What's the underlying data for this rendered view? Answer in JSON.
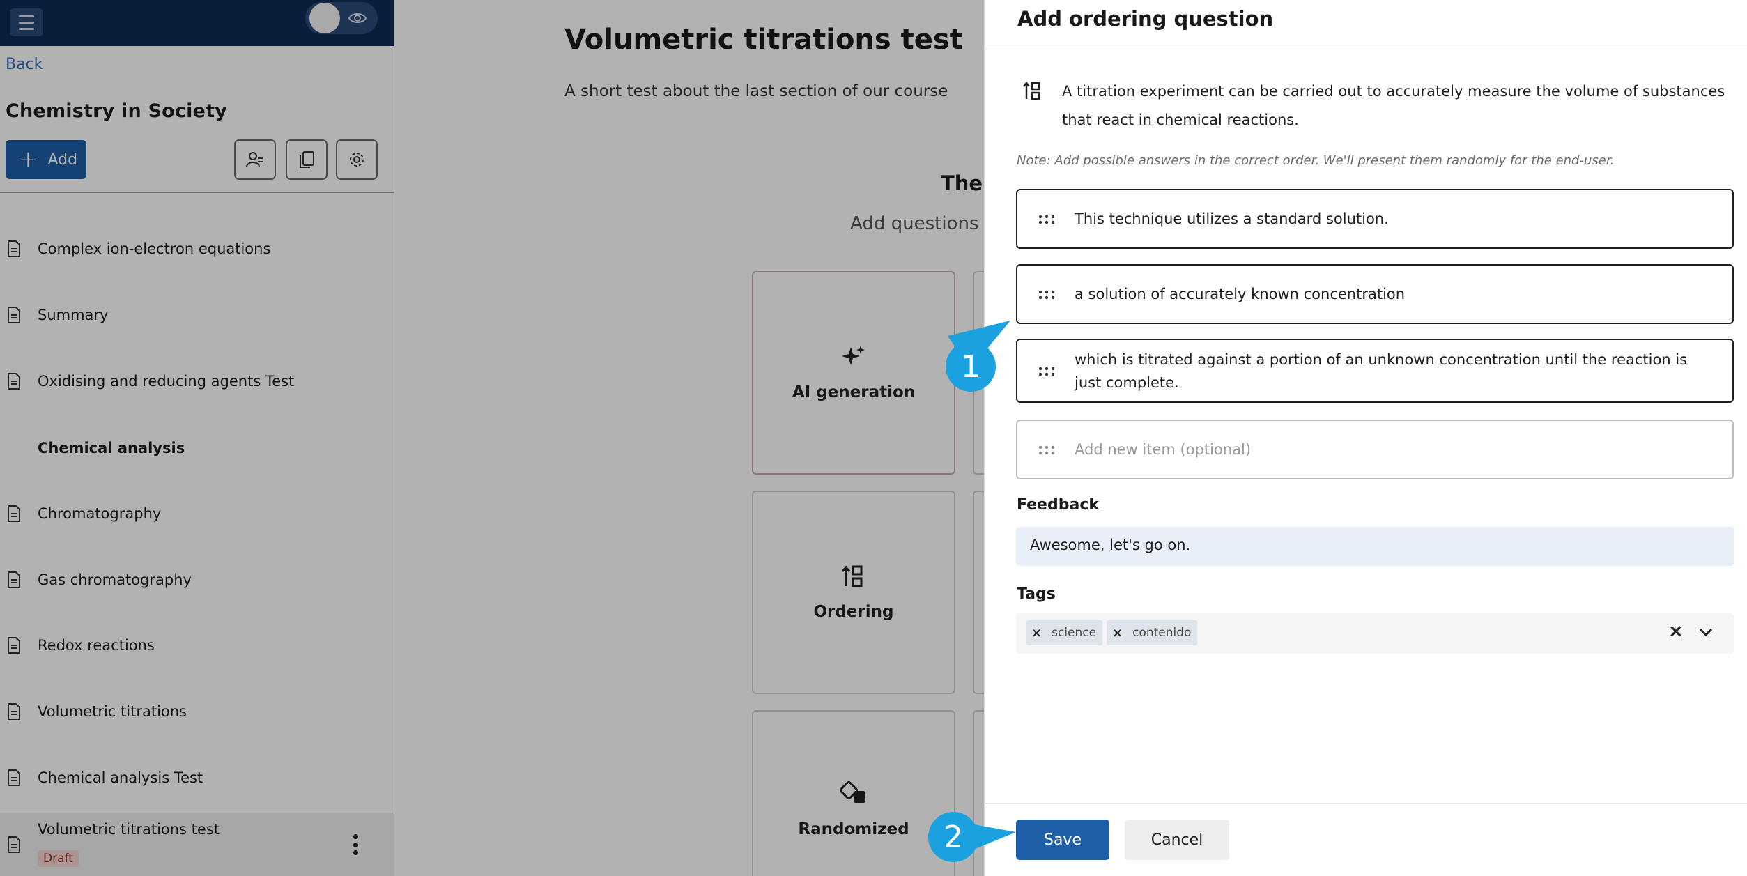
{
  "sidebar": {
    "back": "Back",
    "course_title": "Chemistry in Society",
    "add_label": "Add",
    "items": [
      {
        "label": "Complex ion-electron equations"
      },
      {
        "label": "Summary"
      },
      {
        "label": "Oxidising and reducing agents Test"
      },
      {
        "label": "Chemical analysis"
      },
      {
        "label": "Chromatography"
      },
      {
        "label": "Gas chromatography"
      },
      {
        "label": "Redox reactions"
      },
      {
        "label": "Volumetric titrations"
      },
      {
        "label": "Chemical analysis Test"
      }
    ],
    "current": {
      "label": "Volumetric titrations test",
      "badge": "Draft"
    }
  },
  "main": {
    "title": "Volumetric titrations test",
    "description": "A short test about the last section of our course",
    "empty_heading": "Ther",
    "empty_sub": "Add questions f",
    "cards": [
      {
        "label": "AI generation",
        "icon": "sparkle-icon"
      },
      {
        "label": "Ordering",
        "icon": "ordering-icon"
      },
      {
        "label": "Randomized",
        "icon": "dice-icon"
      }
    ]
  },
  "panel": {
    "title": "Add ordering question",
    "question": "A titration experiment can be carried out to accurately measure the volume of substances that react in chemical reactions.",
    "note": "Note: Add possible answers in the correct order. We'll present them randomly for the end-user.",
    "items": [
      "This technique utilizes a standard solution.",
      "a solution of accurately known concentration",
      "which is titrated against a portion of an unknown concentration until the reaction is just complete."
    ],
    "new_item_placeholder": "Add new item (optional)",
    "feedback_label": "Feedback",
    "feedback_value": "Awesome, let's go on.",
    "tags_label": "Tags",
    "tags": [
      "science",
      "contenido"
    ],
    "save": "Save",
    "cancel": "Cancel"
  },
  "callouts": [
    "1",
    "2"
  ],
  "colors": {
    "primary": "#1f5fa8",
    "topbar": "#0c2b55",
    "callout": "#1ba0e0",
    "draft_bg": "#f6d7d3"
  }
}
